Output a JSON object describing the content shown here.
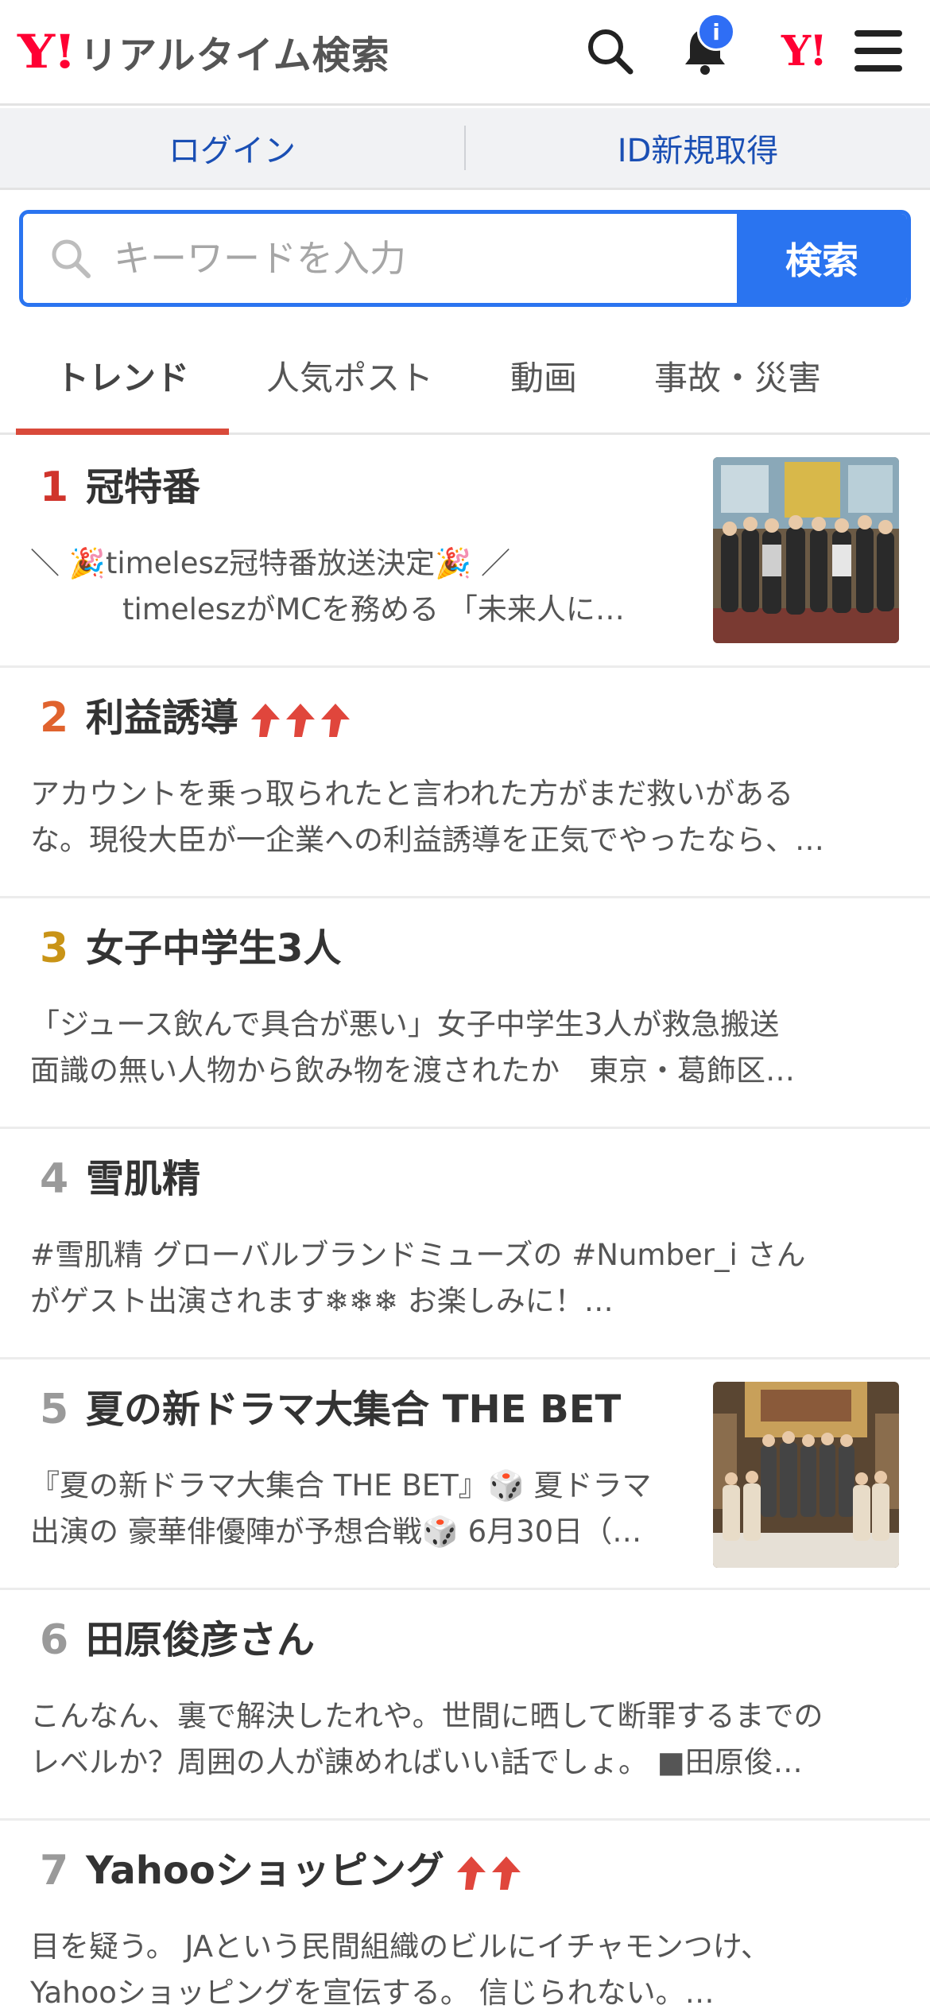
{
  "header": {
    "logo_mark": "Y!",
    "logo_text": "リアルタイム検索",
    "notification_badge": "i",
    "yahoo_mark": "Y!",
    "icons": [
      "search-icon",
      "bell-icon",
      "yahoo-logo",
      "menu-icon"
    ]
  },
  "auth": {
    "login": "ログイン",
    "register": "ID新規取得"
  },
  "search": {
    "placeholder": "キーワードを入力",
    "button": "検索"
  },
  "tabs": [
    "トレンド",
    "人気ポスト",
    "動画",
    "事故・災害"
  ],
  "active_tab": "トレンド",
  "colors": {
    "accent_blue": "#2a74f0",
    "link_blue": "#1a4fb4",
    "yahoo_red": "#ff0033",
    "tab_underline": "#d94a3a",
    "rank1": "#d0342c",
    "rank2": "#e0632e",
    "rank3": "#c99417",
    "rank_other": "#9a9a9a",
    "trend_arrow": "#e0463c"
  },
  "trends": [
    {
      "rank": "1",
      "title": "冠特番",
      "desc_line1": "＼ 🎉timelesz冠特番放送決定🎉 ／",
      "desc_line2": "timeleszがMCを務める 「未来人に…",
      "arrows": 0,
      "has_thumb": true
    },
    {
      "rank": "2",
      "title": "利益誘導",
      "desc_line1": "アカウントを乗っ取られたと言われた方がまだ救いがある",
      "desc_line2": "な。現役大臣が一企業への利益誘導を正気でやったなら、…",
      "arrows": 3,
      "has_thumb": false
    },
    {
      "rank": "3",
      "title": "女子中学生3人",
      "desc_line1": "「ジュース飲んで具合が悪い」女子中学生3人が救急搬送",
      "desc_line2": "面識の無い人物から飲み物を渡されたか　東京・葛飾区…",
      "arrows": 0,
      "has_thumb": false
    },
    {
      "rank": "4",
      "title": "雪肌精",
      "desc_line1": "#雪肌精 グローバルブランドミューズの #Number_i さん",
      "desc_line2": "がゲスト出演されます❄❄❄ お楽しみに！…",
      "arrows": 0,
      "has_thumb": false
    },
    {
      "rank": "5",
      "title": "夏の新ドラマ大集合 THE BET",
      "desc_line1": "『夏の新ドラマ大集合 THE BET』🎲 夏ドラマ",
      "desc_line2": "出演の 豪華俳優陣が予想合戦🎲 6月30日（…",
      "arrows": 0,
      "has_thumb": true
    },
    {
      "rank": "6",
      "title": "田原俊彦さん",
      "desc_line1": "こんなん、裏で解決したれや。世間に晒して断罪するまでの",
      "desc_line2": "レベルか？周囲の人が諌めればいい話でしょ。 ■田原俊…",
      "arrows": 0,
      "has_thumb": false
    },
    {
      "rank": "7",
      "title": "Yahooショッピング",
      "desc_line1": "目を疑う。 JAという民間組織のビルにイチャモンつけ、",
      "desc_line2": "Yahooショッピングを宣伝する。 信じられない。…",
      "arrows": 2,
      "has_thumb": false
    }
  ]
}
